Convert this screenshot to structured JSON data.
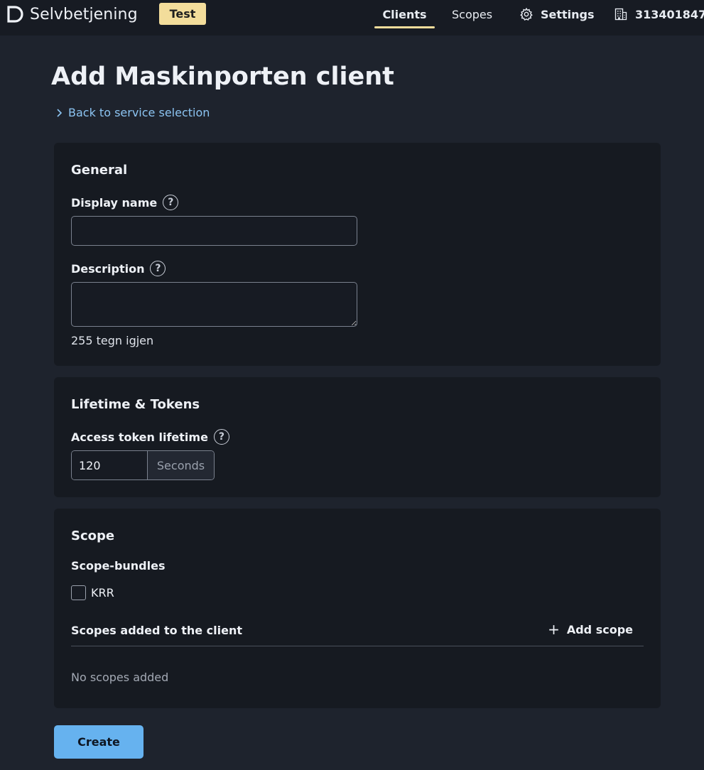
{
  "header": {
    "app_name": "Selvbetjening",
    "env_badge": "Test",
    "nav": {
      "clients": "Clients",
      "scopes": "Scopes",
      "settings": "Settings",
      "org_number": "313401847"
    }
  },
  "page": {
    "title": "Add Maskinporten client",
    "back_link": "Back to service selection"
  },
  "general": {
    "title": "General",
    "display_name_label": "Display name",
    "display_name_value": "",
    "description_label": "Description",
    "description_value": "",
    "char_count": "255 tegn igjen"
  },
  "lifetime": {
    "title": "Lifetime & Tokens",
    "access_token_label": "Access token lifetime",
    "access_token_value": "120",
    "unit": "Seconds"
  },
  "scope": {
    "title": "Scope",
    "bundles_label": "Scope-bundles",
    "bundles": [
      {
        "label": "KRR",
        "checked": false
      }
    ],
    "added_label": "Scopes added to the client",
    "add_button": "Add scope",
    "empty_text": "No scopes added"
  },
  "actions": {
    "create": "Create"
  },
  "colors": {
    "accent": "#f3dd9b",
    "link": "#8cc4f2",
    "primary_button": "#66b2ef",
    "background": "#1e232d",
    "card": "#161a21"
  },
  "icons": {
    "logo": "d-logo-icon",
    "settings": "gear-icon",
    "org": "building-icon",
    "back": "chevron-right-icon",
    "help": "question-circle-icon",
    "add": "plus-icon"
  }
}
